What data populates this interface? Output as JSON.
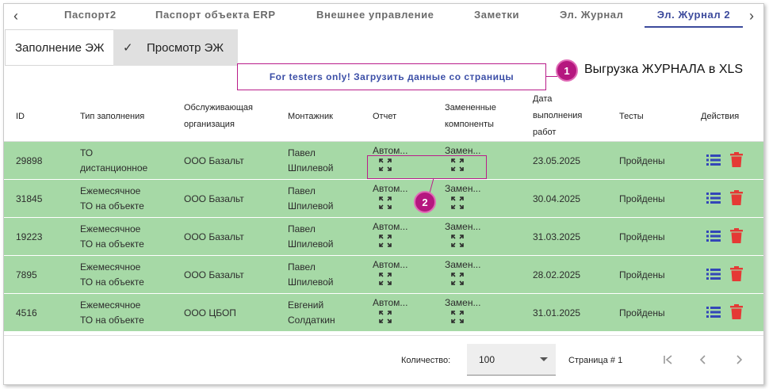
{
  "tabs": [
    {
      "label": "Паспорт2",
      "active": false
    },
    {
      "label": "Паспорт объекта ERP",
      "active": false
    },
    {
      "label": "Внешнее управление",
      "active": false
    },
    {
      "label": "Заметки",
      "active": false
    },
    {
      "label": "Эл. Журнал",
      "active": false
    },
    {
      "label": "Эл. Журнал 2",
      "active": true
    }
  ],
  "toggles": {
    "fill_label": "Заполнение ЭЖ",
    "view_label": "Просмотр ЭЖ"
  },
  "testers_link": "For testers only! Загрузить данные со страницы",
  "callouts": {
    "one_number": "1",
    "one_text": "Выгрузка ЖУРНАЛА в XLS",
    "two_number": "2"
  },
  "columns": {
    "id": "ID",
    "type_1": "Тип заполнения",
    "org_1": "Обслуживающая",
    "org_2": "организация",
    "installer": "Монтажник",
    "report": "Отчет",
    "replaced_1": "Замененные",
    "replaced_2": "компоненты",
    "date_1": "Дата",
    "date_2": "выполнения",
    "date_3": "работ",
    "tests": "Тесты",
    "actions": "Действия"
  },
  "rows": [
    {
      "id": "29898",
      "type_1": "ТО",
      "type_2": "дистанционное",
      "org": "ООО Базальт",
      "installer_1": "Павел",
      "installer_2": "Шпилевой",
      "report": "Автом...",
      "replaced": "Замен...",
      "date": "23.05.2025",
      "tests": "Пройдены"
    },
    {
      "id": "31845",
      "type_1": "Ежемесячное",
      "type_2": "ТО на объекте",
      "org": "ООО Базальт",
      "installer_1": "Павел",
      "installer_2": "Шпилевой",
      "report": "Автом...",
      "replaced": "Замен...",
      "date": "30.04.2025",
      "tests": "Пройдены"
    },
    {
      "id": "19223",
      "type_1": "Ежемесячное",
      "type_2": "ТО на объекте",
      "org": "ООО Базальт",
      "installer_1": "Павел",
      "installer_2": "Шпилевой",
      "report": "Автом...",
      "replaced": "Замен...",
      "date": "31.03.2025",
      "tests": "Пройдены"
    },
    {
      "id": "7895",
      "type_1": "Ежемесячное",
      "type_2": "ТО на объекте",
      "org": "ООО Базальт",
      "installer_1": "Павел",
      "installer_2": "Шпилевой",
      "report": "Автом...",
      "replaced": "Замен...",
      "date": "28.02.2025",
      "tests": "Пройдены"
    },
    {
      "id": "4516",
      "type_1": "Ежемесячное",
      "type_2": "ТО на объекте",
      "org": "ООО ЦБОП",
      "installer_1": "Евгений",
      "installer_2": "Солдаткин",
      "report": "Автом...",
      "replaced": "Замен...",
      "date": "31.01.2025",
      "tests": "Пройдены"
    }
  ],
  "footer": {
    "count_label": "Количество:",
    "count_value": "100",
    "page_label": "Страница # 1"
  },
  "colors": {
    "row_bg": "#a6d9a6",
    "accent": "#3c4a9c",
    "callout": "#b5177f",
    "delete": "#e53935",
    "list_icon": "#3346b8"
  },
  "icons": {
    "tab_prev": "chevron-left-icon",
    "tab_next": "chevron-right-icon",
    "check": "check-icon",
    "expand": "expand-arrows-icon",
    "list": "list-icon",
    "delete": "trash-icon",
    "first_page": "first-page-icon",
    "prev_page": "chevron-left-icon",
    "next_page": "chevron-right-icon"
  }
}
